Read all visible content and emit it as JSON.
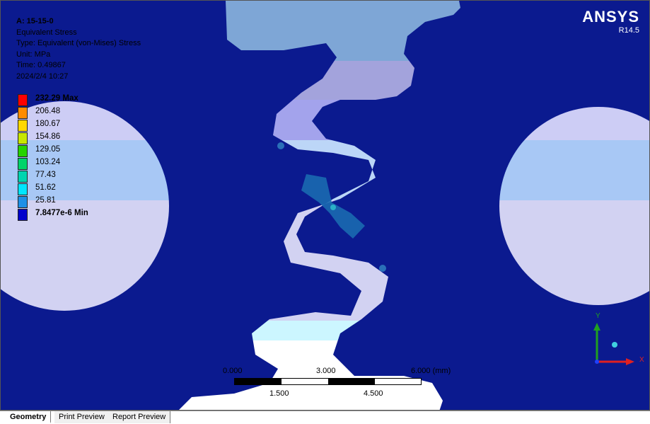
{
  "result_info": {
    "title": "A: 15-15-0",
    "lines": [
      "Equivalent Stress",
      "Type: Equivalent (von-Mises) Stress",
      "Unit: MPa",
      "Time: 0.49867",
      "2024/2/4 10:27"
    ]
  },
  "legend": [
    {
      "label": "232.29 Max",
      "color": "#ff0000",
      "bold": true
    },
    {
      "label": "206.48",
      "color": "#ff8c00",
      "bold": false
    },
    {
      "label": "180.67",
      "color": "#ffd800",
      "bold": false
    },
    {
      "label": "154.86",
      "color": "#c8e600",
      "bold": false
    },
    {
      "label": "129.05",
      "color": "#26d400",
      "bold": false
    },
    {
      "label": "103.24",
      "color": "#00d46a",
      "bold": false
    },
    {
      "label": "77.43",
      "color": "#00d4b0",
      "bold": false
    },
    {
      "label": "51.62",
      "color": "#00e6ff",
      "bold": false
    },
    {
      "label": "25.81",
      "color": "#1e90e6",
      "bold": false
    },
    {
      "label": "7.8477e-6 Min",
      "color": "#0000cc",
      "bold": true
    }
  ],
  "brand": {
    "name": "ANSYS",
    "version": "R14.5"
  },
  "scale": {
    "top_labels": [
      "0.000",
      "3.000",
      "6.000 (mm)"
    ],
    "bottom_labels": [
      "1.500",
      "4.500"
    ]
  },
  "axes": {
    "y": "Y",
    "x": "X"
  },
  "tabs": [
    "Geometry",
    "Print Preview",
    "Report Preview"
  ],
  "colors": {
    "background": "#0b1a8f",
    "x_axis": "#e02020",
    "y_axis": "#20a020"
  }
}
